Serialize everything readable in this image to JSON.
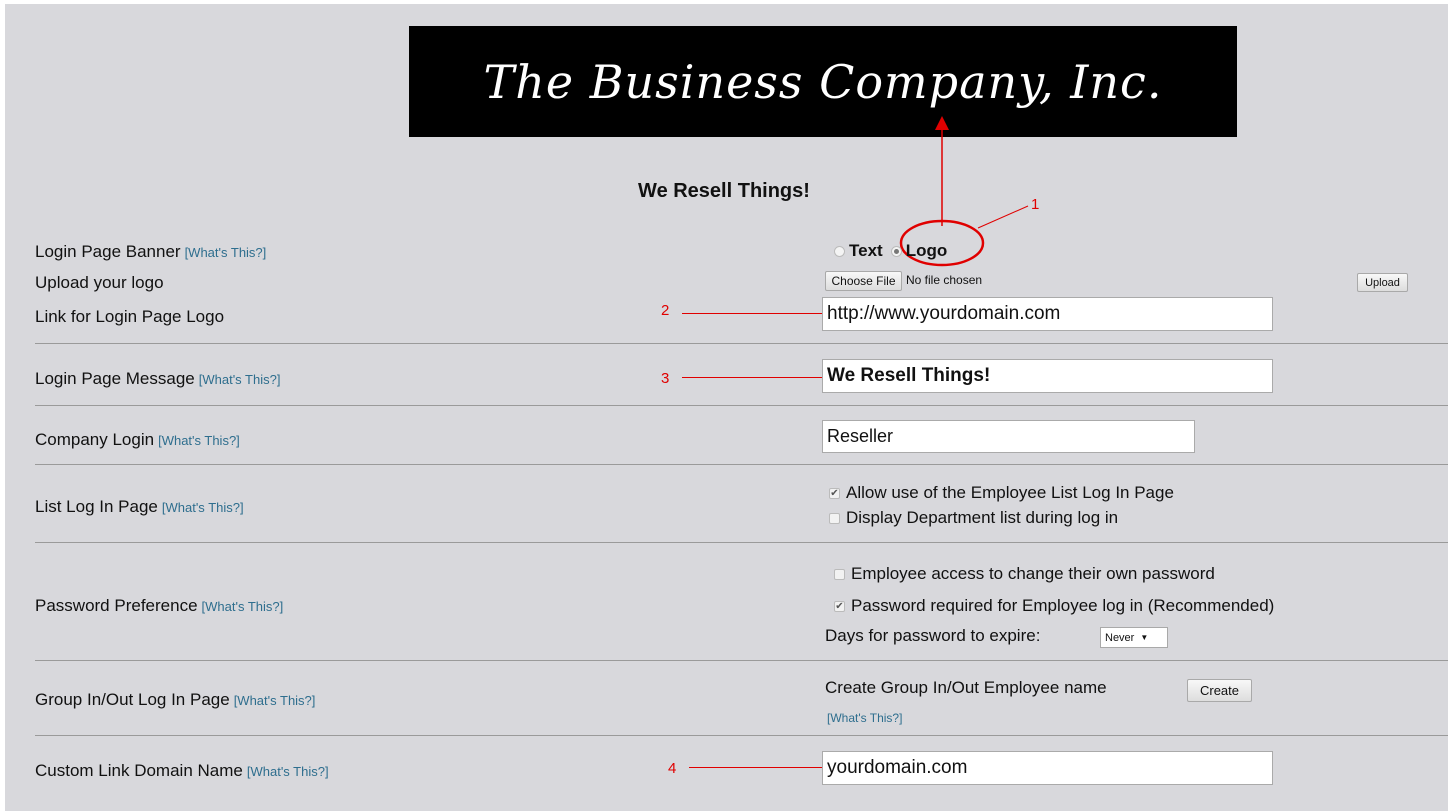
{
  "banner": {
    "text": "The Business Company, Inc."
  },
  "headline": "We Resell Things!",
  "whats_this": "[What's This?]",
  "rows": {
    "login_banner": {
      "label": "Login Page Banner",
      "options": [
        "Text",
        "Logo"
      ],
      "selected": "Logo"
    },
    "upload_logo": {
      "label": "Upload your logo",
      "choose_file": "Choose File",
      "no_file": "No file chosen",
      "upload_button": "Upload"
    },
    "logo_link": {
      "label": "Link for Login Page Logo",
      "value": "http://www.yourdomain.com"
    },
    "login_message": {
      "label": "Login Page Message",
      "value": "We Resell Things!"
    },
    "company_login": {
      "label": "Company Login",
      "value": "Reseller"
    },
    "list_login": {
      "label": "List Log In Page",
      "options": [
        {
          "label": "Allow use of the Employee List Log In Page",
          "checked": true
        },
        {
          "label": "Display Department list during log in",
          "checked": false
        }
      ]
    },
    "password_pref": {
      "label": "Password Preference",
      "options": [
        {
          "label": "Employee access to change their own password",
          "checked": false
        },
        {
          "label": "Password required for Employee log in (Recommended)",
          "checked": true
        }
      ],
      "expire_label": "Days for password to expire:",
      "expire_value": "Never"
    },
    "group_login": {
      "label": "Group In/Out Log In Page",
      "create_label": "Create Group In/Out Employee name",
      "create_button": "Create"
    },
    "custom_domain": {
      "label": "Custom Link Domain Name",
      "value": "yourdomain.com"
    }
  },
  "annotations": [
    "1",
    "2",
    "3",
    "4"
  ],
  "colors": {
    "panel": "#d8d8dc",
    "banner": "#000000",
    "link": "#2e6e8e",
    "annotation": "#e00000"
  }
}
